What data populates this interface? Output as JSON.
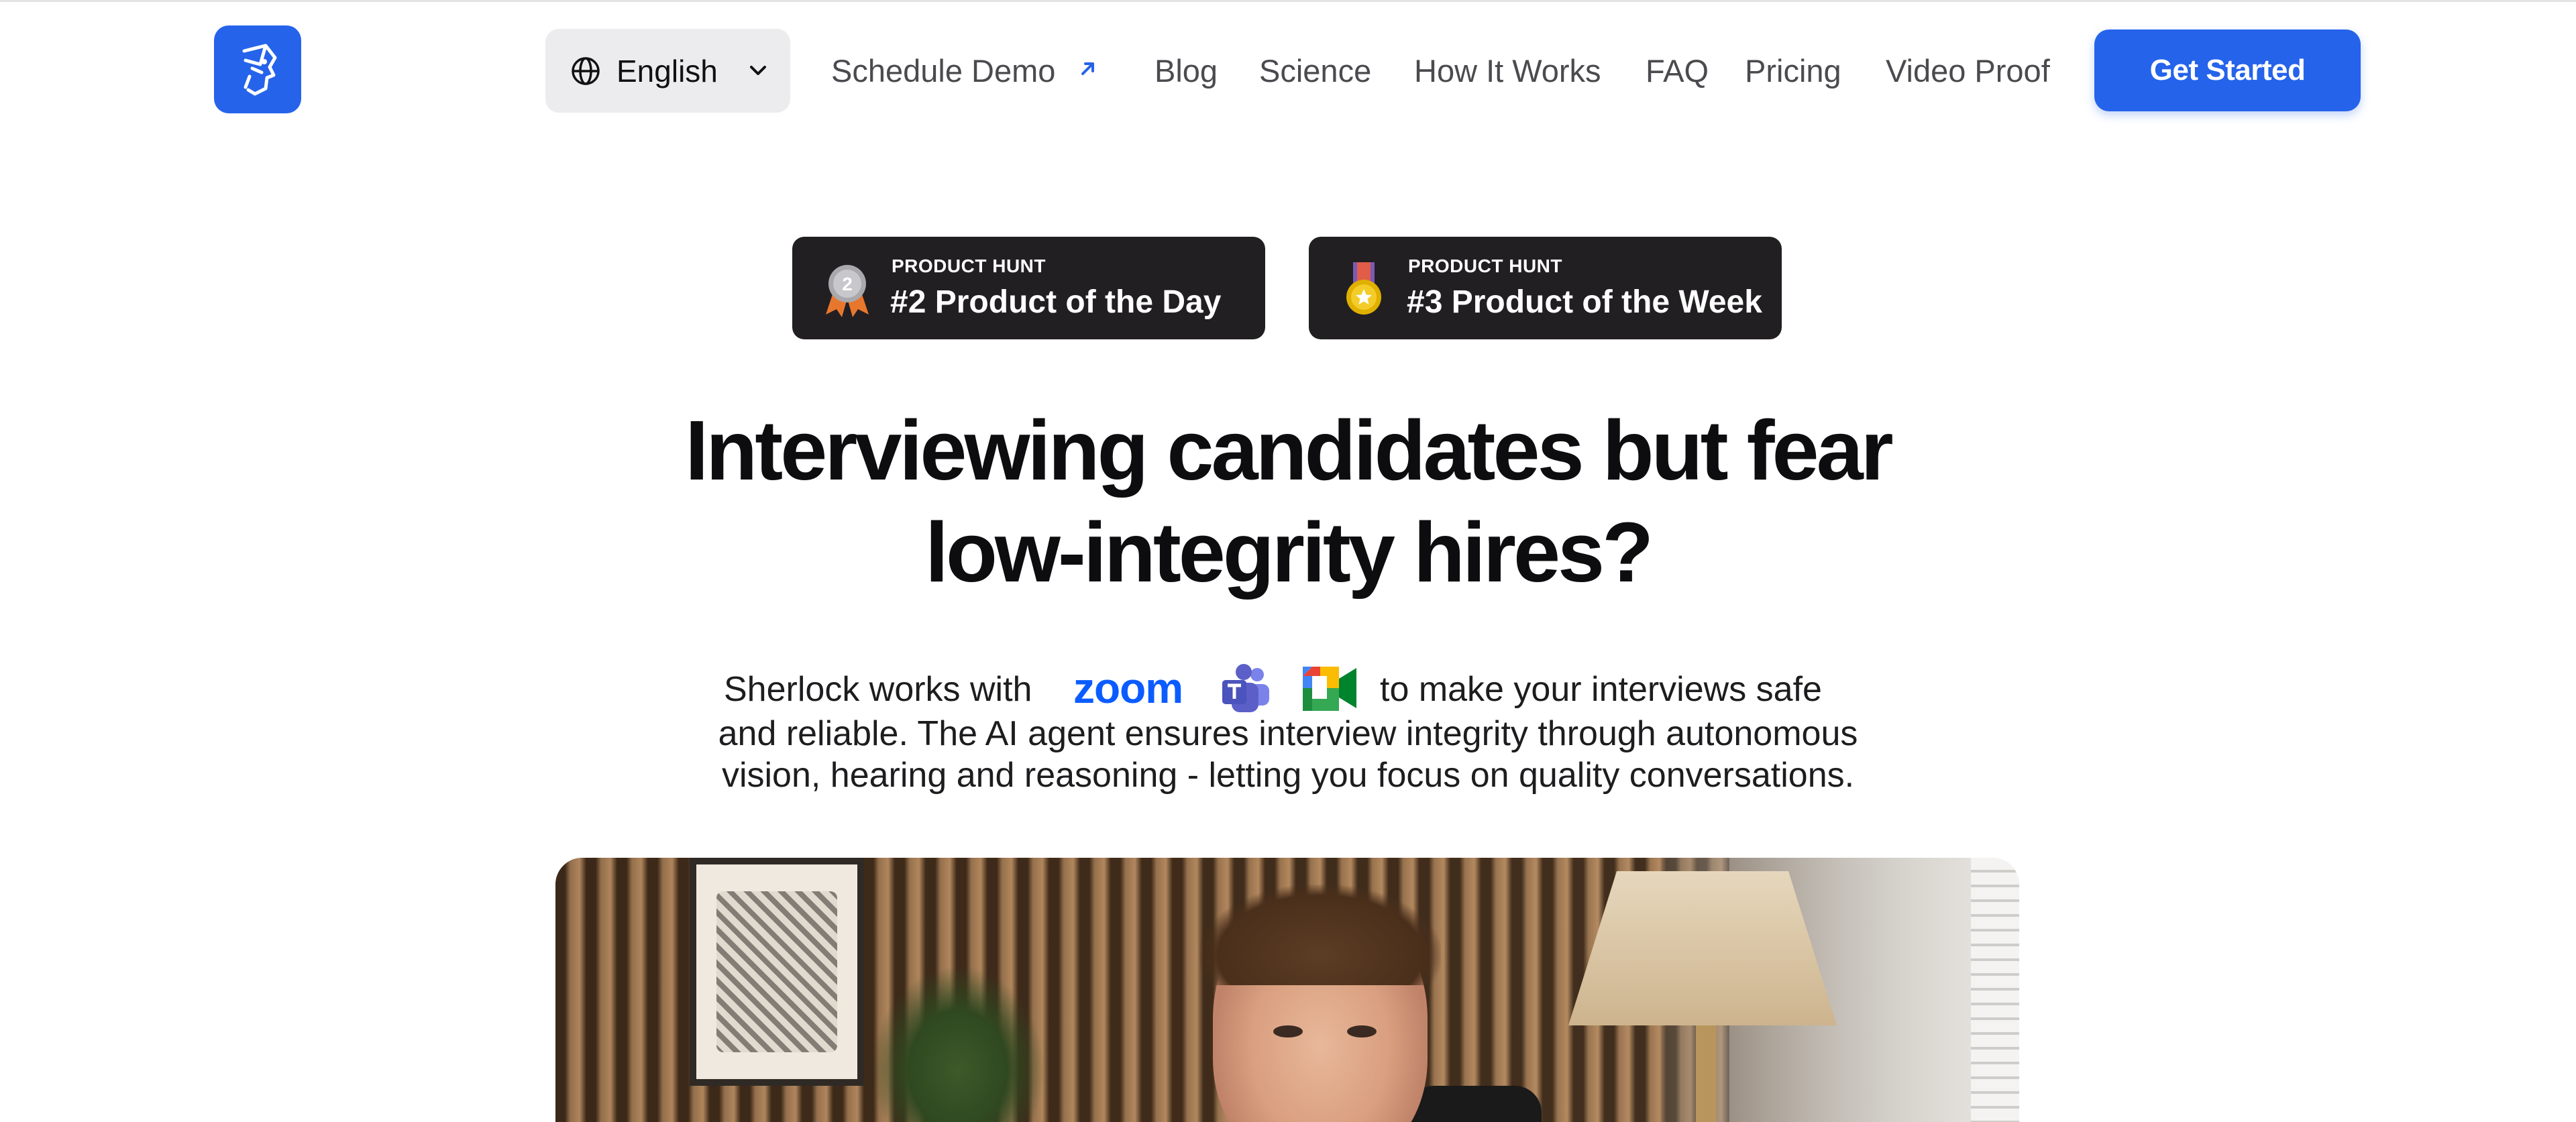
{
  "nav": {
    "language": "English",
    "links": [
      "Schedule Demo",
      "Blog",
      "Science",
      "How It Works",
      "FAQ",
      "Pricing",
      "Video Proof"
    ],
    "cta": "Get Started"
  },
  "badges": [
    {
      "source": "PRODUCT HUNT",
      "title": "#2 Product of the Day",
      "medal": "silver-medal-icon",
      "rank": "2"
    },
    {
      "source": "PRODUCT HUNT",
      "title": "#3 Product of the Week",
      "medal": "gold-medal-icon"
    }
  ],
  "hero": {
    "headline_line1": "Interviewing candidates but fear",
    "headline_line2": "low-integrity hires?",
    "sub_prefix": "Sherlock works with",
    "zoom_text": "zoom",
    "sub_suffix": "to make your interviews safe",
    "sub_line2": "and reliable. The AI agent ensures interview integrity through autonomous",
    "sub_line3": "vision, hearing and reasoning - letting you focus on quality conversations."
  },
  "integrations": [
    "zoom-logo-icon",
    "microsoft-teams-icon",
    "google-meet-icon"
  ],
  "colors": {
    "accent": "#2563eb",
    "badge_bg": "#221f22",
    "zoom_blue": "#0b5cff",
    "teams_purple": "#5b5fc7"
  },
  "video": {
    "type": "hero-video-preview"
  }
}
